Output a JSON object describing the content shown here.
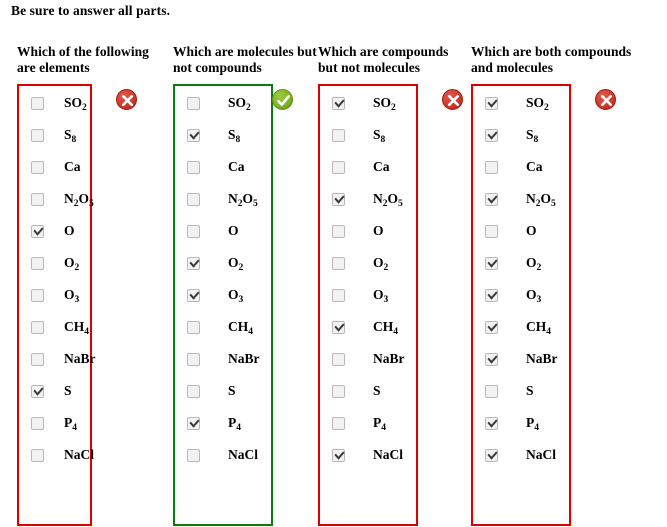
{
  "instruction": "Be sure to answer all parts.",
  "colors": {
    "incorrect_border": "#dd0000",
    "correct_border": "#0b7a11",
    "incorrect_icon": "#cf3a2b",
    "correct_icon": "#82b626"
  },
  "species": [
    {
      "name": "SO2",
      "formula_html": "SO<sub>2</sub>"
    },
    {
      "name": "S8",
      "formula_html": "S<sub>8</sub>"
    },
    {
      "name": "Ca",
      "formula_html": "Ca"
    },
    {
      "name": "N2O5",
      "formula_html": "N<sub>2</sub>O<sub>5</sub>"
    },
    {
      "name": "O",
      "formula_html": "O"
    },
    {
      "name": "O2",
      "formula_html": "O<sub>2</sub>"
    },
    {
      "name": "O3",
      "formula_html": "O<sub>3</sub>"
    },
    {
      "name": "CH4",
      "formula_html": "CH<sub>4</sub>"
    },
    {
      "name": "NaBr",
      "formula_html": "NaBr"
    },
    {
      "name": "S",
      "formula_html": "S"
    },
    {
      "name": "P4",
      "formula_html": "P<sub>4</sub>"
    },
    {
      "name": "NaCl",
      "formula_html": "NaCl"
    }
  ],
  "columns": [
    {
      "heading": "Which of the following are elements",
      "status": "incorrect",
      "status_icon": "circle-x-icon",
      "wide": false,
      "checked": [
        false,
        false,
        false,
        false,
        true,
        false,
        false,
        false,
        false,
        true,
        false,
        false
      ]
    },
    {
      "heading": "Which are molecules but not compounds",
      "status": "correct",
      "status_icon": "circle-check-icon",
      "wide": true,
      "checked": [
        false,
        true,
        false,
        false,
        false,
        true,
        true,
        false,
        false,
        false,
        true,
        false
      ]
    },
    {
      "heading": "Which are compounds but not molecules",
      "status": "incorrect",
      "status_icon": "circle-x-icon",
      "wide": true,
      "checked": [
        true,
        false,
        false,
        true,
        false,
        false,
        false,
        true,
        false,
        false,
        false,
        true
      ]
    },
    {
      "heading": "Which are both compounds and molecules",
      "status": "incorrect",
      "status_icon": "circle-x-icon",
      "wide": true,
      "checked": [
        true,
        true,
        false,
        true,
        false,
        true,
        true,
        true,
        true,
        false,
        true,
        true
      ]
    }
  ]
}
